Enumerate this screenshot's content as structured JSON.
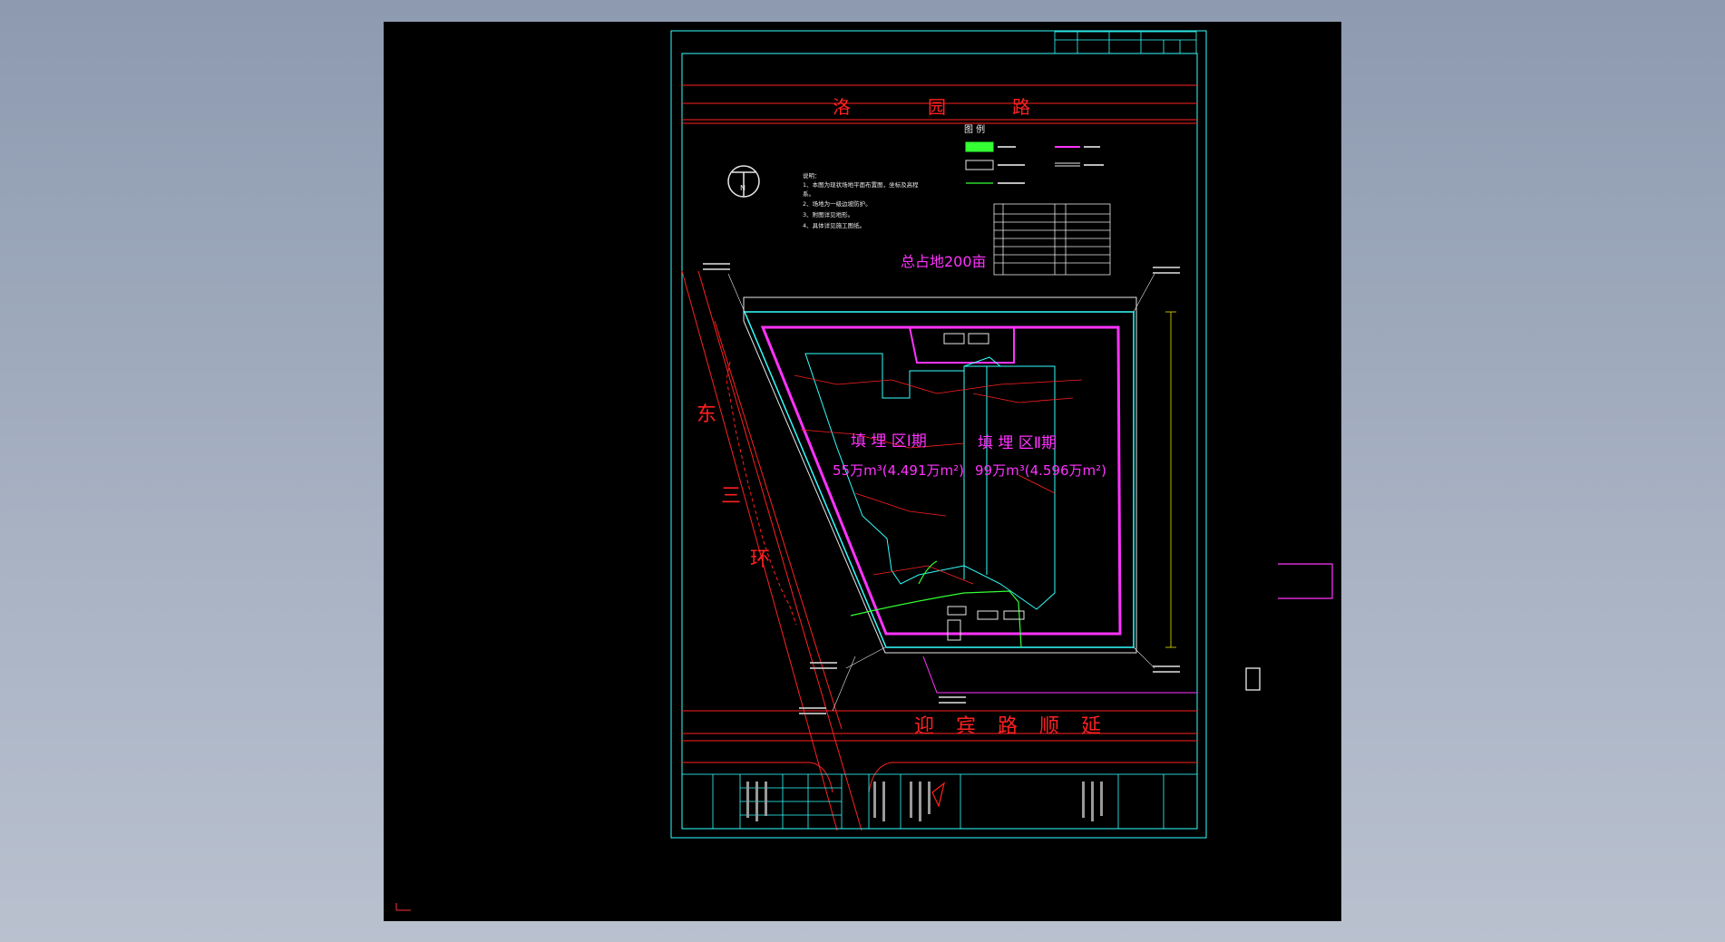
{
  "roads": {
    "north": [
      "洛",
      "园",
      "路"
    ],
    "south": [
      "迎",
      "宾",
      "路",
      "顺",
      "延"
    ],
    "west": [
      "东",
      "三",
      "环"
    ]
  },
  "site": {
    "total_area": "总占地200亩",
    "zone1_title": "填 埋 区Ⅰ期",
    "zone1_area": "55万m³(4.491万m²)",
    "zone2_title": "填 埋 区Ⅱ期",
    "zone2_area": "99万m³(4.596万m²)"
  },
  "legend": {
    "title": "图 例"
  },
  "notes": {
    "title": "说明：",
    "lines": [
      "1、本图为现状场地平面布置图，坐标及高程",
      "系。",
      "2、场地为一级边坡防护。",
      "3、附图详见地形。",
      "4、具体详见施工图纸。"
    ]
  },
  "colors": {
    "road": "#ff2020",
    "boundary": "#ff33ff",
    "frame": "#33ffff",
    "text": "#e8e8e8",
    "accent_green": "#33ff33",
    "ucs_icon": "#ff3030"
  },
  "icons": {
    "north_arrow": "north-arrow-icon",
    "ucs": "ucs-axis-icon"
  }
}
